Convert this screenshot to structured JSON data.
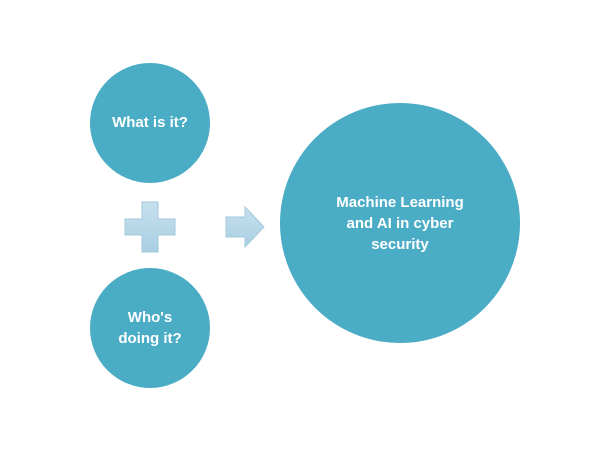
{
  "colors": {
    "circle_fill": "#4bacc6",
    "connector_fill": "#b7d7e8",
    "connector_shadow": "#9fc4d8",
    "text": "#ffffff",
    "background": "#ffffff"
  },
  "nodes": {
    "what": {
      "label": "What is it?"
    },
    "who": {
      "label": "Who's\ndoing it?"
    },
    "result": {
      "label": "Machine Learning\nand AI in cyber\nsecurity"
    }
  },
  "connectors": {
    "plus": {
      "icon": "plus-icon"
    },
    "arrow": {
      "icon": "arrow-right-icon"
    }
  }
}
